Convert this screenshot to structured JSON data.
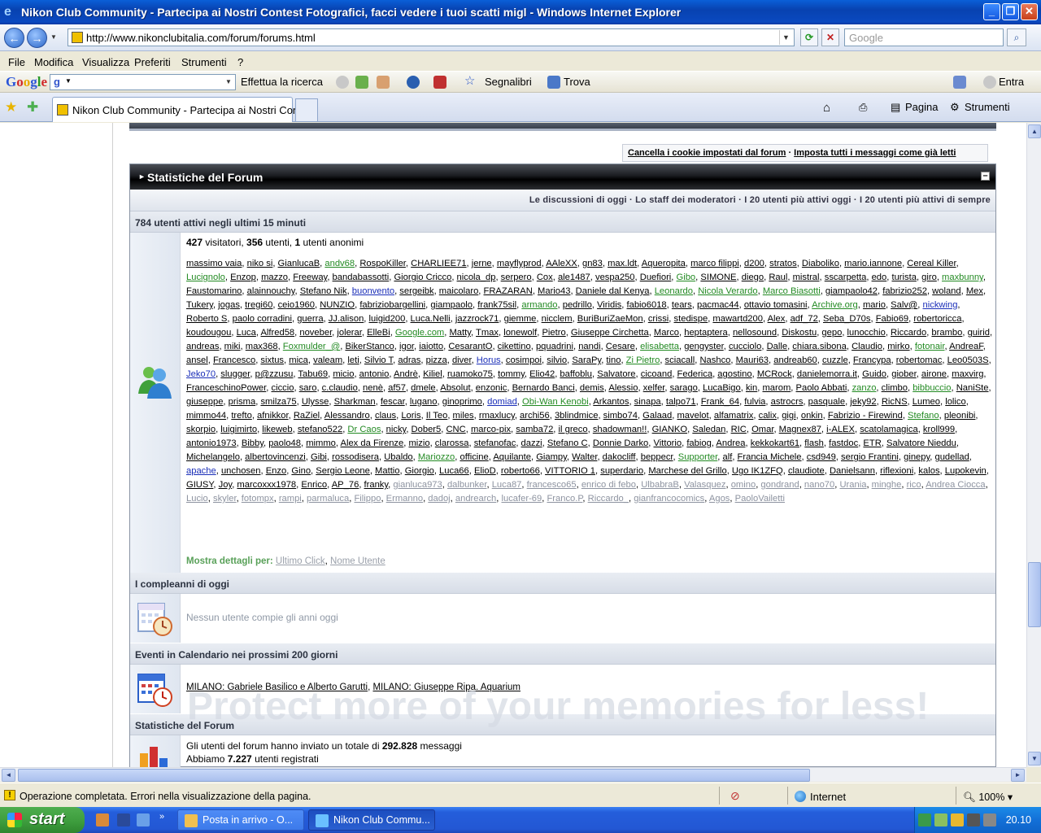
{
  "window": {
    "title": "Nikon Club Community - Partecipa ai Nostri Contest Fotografici, facci vedere i tuoi scatti migl - Windows Internet Explorer"
  },
  "address": {
    "url": "http://www.nikonclubitalia.com/forum/forums.html",
    "search_placeholder": "Google"
  },
  "menu": [
    "File",
    "Modifica",
    "Visualizza",
    "Preferiti",
    "Strumenti",
    "?"
  ],
  "google_toolbar": {
    "logo": "Google",
    "g": "g",
    "search_label": "Effettua la ricerca",
    "bookmarks": "Segnalibri",
    "find": "Trova",
    "signin": "Entra"
  },
  "tabs": {
    "active_label": "Nikon Club Community - Partecipa ai Nostri Con...",
    "home": "",
    "page_menu": "Pagina",
    "tools_menu": "Strumenti"
  },
  "page": {
    "cookie_link": "Cancella i cookie impostati dal forum",
    "cookie_sep": " · ",
    "read_link": "Imposta tutti i messaggi come già letti",
    "panel_title": "Statistiche del Forum",
    "collapse": "–",
    "links_bar": "Le discussioni di oggi · Lo staff dei moderatori · I 20 utenti più attivi oggi · I 20 utenti più attivi di sempre",
    "active_header": "784 utenti attivi negli ultimi 15 minuti",
    "counts": {
      "visitors": "427",
      "visitors_label": " visitatori, ",
      "users": "356",
      "users_label": " utenti, ",
      "anon": "1",
      "anon_label": " utenti anonimi"
    },
    "mostra_label": "Mostra dettagli per:",
    "mostra_link1": "Ultimo Click",
    "mostra_link2": "Nome Utente",
    "birthday_header": "I compleanni di oggi",
    "no_birthday": "Nessun utente compie gli anni oggi",
    "events_header": "Eventi in Calendario nei prossimi 200 giorni",
    "event1": "MILANO: Gabriele Basilico e Alberto Garutti",
    "event2": "MILANO: Giuseppe Ripa. Aquarium",
    "stats_header": "Statistiche del Forum",
    "stats_line1_pre": "Gli utenti del forum hanno inviato un totale di ",
    "stats_posts": "292.828",
    "stats_line1_post": " messaggi",
    "stats_line2_pre": "Abbiamo ",
    "stats_users": "7.227",
    "stats_line2_post": " utenti registrati",
    "watermark": "Protect more of your memories for less!"
  },
  "users_text": "massimo vaia, niko si, GianlucaB, andv68, RospoKiller, CHARLIEE71, jerne, mayflyprod, AAleXX, gn83, max.ldt, Aqueropita, marco filippi, d200, stratos, Diaboliko, mario.iannone, Cereal Killer, Lucignolo, Enzop, mazzo, Freeway, bandabassotti, Giorgio Cricco, nicola_dp, serpero, Cox, ale1487, vespa250, Duefiori, Gibo, SIMONE, diego, Raul, mistral, sscarpetta, edo, turista, giro, maxbunny, Faustomarino, alainnouchy, Stefano Nik, buonvento, sergeibk, maicolaro, FRAZARAN, Mario43, Daniele dal Kenya, Leonardo, Nicola Verardo, Marco Biasotti, giampaolo42, fabrizio252, woland, Mex, Tukery, jogas, tregi60, ceio1960, NUNZIO, fabriziobargellini, giampaolo, frank75sil, armando, pedrillo, Viridis, fabio6018, tears, pacmac44, ottavio tomasini, Archive.org, mario, Salv@, nickwing, Roberto S, paolo corradini, guerra, JJ.alison, luigid200, Luca.Nelli, jazzrock71, giemme, nicclem, BuriBuriZaeMon, crissi, stedispe, mawartd200, Alex, adf_72, Seba_D70s, Fabio69, robertoricca, koudougou, Luca, Alfred58, noveber, jolerar, ElleBi, Google.com, Matty, Tmax, lonewolf, Pietro, Giuseppe Circhetta, Marco, heptaptera, nellosound, Diskostu, gepo, lunocchio, Riccardo, brambo, guirid, andreas, miki, max368, Foxmulder_@, BikerStanco, igor, iaiotto, CesarantO, cikettino, pquadrini, nandi, Cesare, elisabetta, gengyster, cucciolo, Dalle, chiara.sibona, Claudio, mirko, fotonair, AndreaF, ansel, Francesco, sixtus, mica, valeam, leti, Silvio T, adras, pizza, diver, Horus, cosimpoi, silvio, SaraPy, tino, Zi Pietro, sciacall, Nashco, Mauri63, andreab60, cuzzle, Francypa, robertomac, Leo0503S, Jeko70, slugger, p@zzusu, Tabu69, micio, antonio, Andrè, Kiliel, ruamoko75, tommy, Elio42, baffoblu, Salvatore, cicoand, Federica, agostino, MCRock, danielemorra.it, Guido, giober, airone, maxvirg, FranceschinoPower, ciccio, saro, c.claudio, nenè, af57, dmele, Absolut, enzonic, Bernardo Banci, demis, Alessio, xelfer, sarago, LucaBigo, kin, marom, Paolo Abbati, zanzo, climbo, bibbuccio, NaniSte, giuseppe, prisma, smilza75, Ulysse, Sharkman, fescar, lugano, ginoprimo, domiad, Obi-Wan Kenobi, Arkantos, sinapa, talpo71, Frank_64, fulvia, astrocrs, pasquale, jeky92, RicNS, Lumeo, lolico, mimmo44, trefto, afnikkor, RaZiel, Alessandro, claus, Loris, Il Teo, miles, rmaxlucy, archi56, 3blindmice, simbo74, Galaad, mavelot, alfamatrix, calix, gigi, onkin, Fabrizio - Firewind, Stefano, pleonibi, skorpio, luigimirto, likeweb, stefano522, Dr Caos, nicky, Dober5, CNC, marco-pix, samba72, il greco, shadowman!!, GIANKO, Saledan, RIC, Omar, Magnex87, i-ALEX, scatolamagica, kroll999, antonio1973, Bibby, paolo48, mimmo, Alex da Firenze, mizio, clarossa, stefanofac, dazzi, Stefano C, Donnie Darko, Vittorio, fabiog, Andrea, kekkokart61, flash, fastdoc, ETR, Salvatore Nieddu, Michelangelo, albertovincenzi, Gibi, rossodisera, Ubaldo, Mariozzo, officine, Aquilante, Giampy, Walter, dakocliff, beppecr, Supporter, alf, Francia Michele, csd949, sergio Frantini, ginepy, gudellad, apache, unchosen, Enzo, Gino, Sergio Leone, Mattio, Giorgio, Luca66, ElioD, roberto66, VITTORIO 1, superdario, Marchese del Grillo, Ugo IK1ZFQ, claudiote, Danielsann, riflexioni, kalos, Lupokevin, GIUSY, Joy, marcoxxx1978, Enrico, AP_76, franky, gianluca973, dalbunker, Luca87, francesco65, enrico di febo, UlbabraB, Valasquez, omino, gondrand, nano70, Urania, minghe, rico, Andrea Ciocca, Lucio, skyler, fotompx, rampi, parmaluca, Filippo, Ermanno, dadoj, andrearch, lucafer-69, Franco.P, Riccardo_, gianfrancocomics, Agos, PaoloVailetti",
  "status": {
    "message": "Operazione completata. Errori nella visualizzazione della pagina.",
    "zone": "Internet",
    "zoom": "100%"
  },
  "taskbar": {
    "start": "start",
    "task1": "Posta in arrivo - O...",
    "task2": "Nikon Club Commu...",
    "clock": "20.10"
  },
  "colors": {
    "green_user": "#238a23",
    "blue_user": "#1a2eb8",
    "titlebar": "#0a49c0"
  }
}
